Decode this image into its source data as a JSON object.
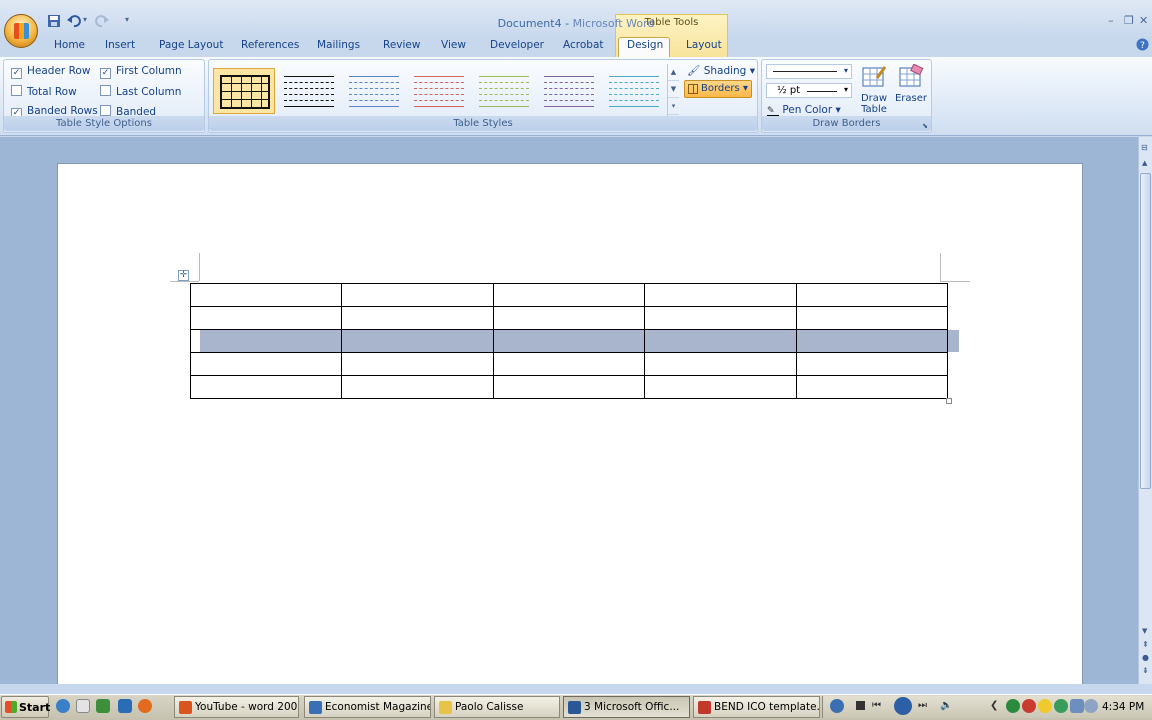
{
  "window": {
    "document_name": "Document4",
    "separator": " - ",
    "app_name": "Microsoft Word",
    "context_group": "Table Tools"
  },
  "tabs": [
    "Home",
    "Insert",
    "Page Layout",
    "References",
    "Mailings",
    "Review",
    "View",
    "Developer",
    "Acrobat",
    "Design",
    "Layout"
  ],
  "active_tab": "Design",
  "table_style_options": {
    "label": "Table Style Options",
    "options": [
      {
        "label": "Header Row",
        "checked": true
      },
      {
        "label": "First Column",
        "checked": true
      },
      {
        "label": "Total Row",
        "checked": false
      },
      {
        "label": "Last Column",
        "checked": false
      },
      {
        "label": "Banded Rows",
        "checked": true
      },
      {
        "label": "Banded Columns",
        "checked": false
      }
    ]
  },
  "table_styles": {
    "label": "Table Styles",
    "swatch_colors": [
      "#111111",
      "#111111",
      "#5b86c4",
      "#d4625e",
      "#9bbb59",
      "#8064a2",
      "#4bacc6"
    ],
    "shading_label": "Shading",
    "borders_label": "Borders"
  },
  "draw_borders": {
    "label": "Draw Borders",
    "line_weight": "½ pt",
    "pen_color_label": "Pen Color",
    "draw_table_line1": "Draw",
    "draw_table_line2": "Table",
    "eraser_label": "Eraser"
  },
  "document_table": {
    "rows": 5,
    "columns": 5,
    "selected_row": 3
  },
  "taskbar": {
    "start_label": "Start",
    "tasks": [
      {
        "label": "YouTube - word 200...",
        "color": "#d9541e"
      },
      {
        "label": "Economist Magazine ...",
        "color": "#3a6fb5"
      },
      {
        "label": "Paolo Calisse",
        "color": "#e8c34a"
      },
      {
        "label": "3 Microsoft Offic...",
        "color": "#2b5797",
        "active": true
      },
      {
        "label": "BEND ICO template....",
        "color": "#c0392b"
      }
    ],
    "clock": "4:34 PM"
  },
  "colors": {
    "ribbon_bg": "#dbe7f5",
    "context_tab": "#f7e39a",
    "selection": "#a9b5cc"
  }
}
